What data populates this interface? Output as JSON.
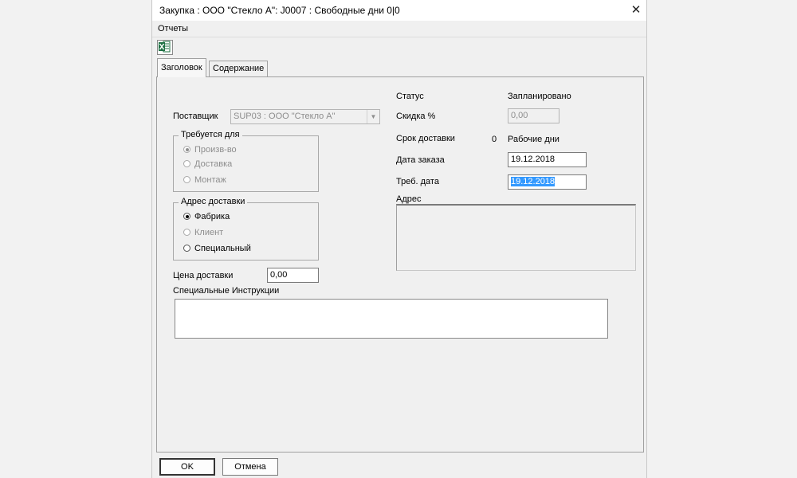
{
  "window": {
    "title": "Закупка : ООО \"Стекло А\": J0007  : Свободные дни 0|0",
    "close_glyph": "✕"
  },
  "menu": {
    "reports": "Отчеты"
  },
  "toolbar": {
    "excel_icon": "excel-export-icon"
  },
  "tabs": [
    {
      "label": "Заголовок",
      "active": true
    },
    {
      "label": "Содержание",
      "active": false
    }
  ],
  "supplier": {
    "label": "Поставщик",
    "value": "SUP03 : ООО \"Стекло А\""
  },
  "required_for": {
    "title": "Требуется для",
    "options": [
      {
        "label": "Произв-во",
        "checked": true,
        "enabled": false
      },
      {
        "label": "Доставка",
        "checked": false,
        "enabled": false
      },
      {
        "label": "Монтаж",
        "checked": false,
        "enabled": false
      }
    ]
  },
  "delivery_address": {
    "title": "Адрес доставки",
    "options": [
      {
        "label": "Фабрика",
        "checked": true,
        "enabled": true
      },
      {
        "label": "Клиент",
        "checked": false,
        "enabled": false
      },
      {
        "label": "Специальный",
        "checked": false,
        "enabled": true
      }
    ]
  },
  "delivery_price": {
    "label": "Цена доставки",
    "value": "0,00"
  },
  "special_instructions": {
    "label": "Специальные Инструкции",
    "value": ""
  },
  "status": {
    "label": "Статус",
    "value": "Запланировано"
  },
  "discount": {
    "label": "Скидка %",
    "value": "0,00"
  },
  "lead_time": {
    "label": "Срок доставки",
    "value": "0",
    "unit": "Рабочие дни"
  },
  "order_date": {
    "label": "Дата заказа",
    "value": "19.12.2018"
  },
  "required_date": {
    "label": "Треб. дата",
    "value": "19.12.2018"
  },
  "address": {
    "label": "Адрес",
    "value": ""
  },
  "buttons": {
    "ok": "OK",
    "cancel": "Отмена"
  }
}
